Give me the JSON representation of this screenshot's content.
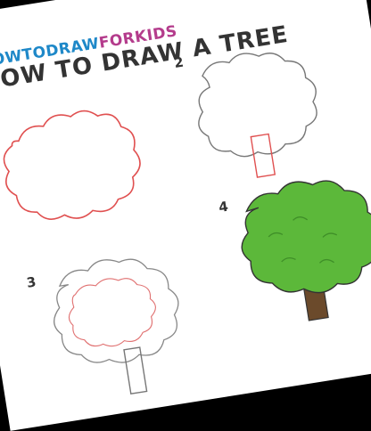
{
  "brand": {
    "part1": "HOWTODRAW",
    "part2": "FORKIDS"
  },
  "title": "HOW TO DRAW A TREE",
  "steps": [
    {
      "number": "2"
    },
    {
      "number": "3"
    },
    {
      "number": "4"
    }
  ],
  "colors": {
    "outline": "#555555",
    "guide_red": "#e05050",
    "foliage_green": "#5cb83a",
    "foliage_shadow": "#3f8f28",
    "trunk_brown": "#6b4a2b"
  }
}
